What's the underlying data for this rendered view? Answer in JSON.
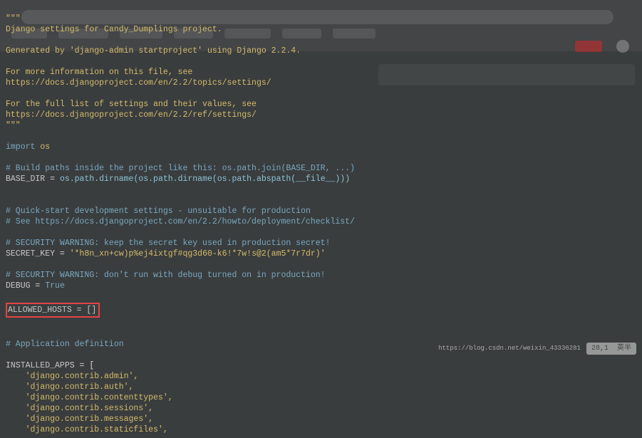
{
  "code": {
    "docstring_open": "\"\"\"",
    "l1": "Django settings for Candy_Dumplings project.",
    "l2": "Generated by 'django-admin startproject' using Django 2.2.4.",
    "l3": "For more information on this file, see",
    "l4": "https://docs.djangoproject.com/en/2.2/topics/settings/",
    "l5": "For the full list of settings and their values, see",
    "l6": "https://docs.djangoproject.com/en/2.2/ref/settings/",
    "docstring_close": "\"\"\"",
    "imp_kw": "import",
    "imp_mod": "os",
    "cmt_build": "# Build paths inside the project like this: os.path.join(BASE_DIR, ...)",
    "base_dir_var": "BASE_DIR",
    "base_dir_eq": " = ",
    "base_dir_expr": "os.path.dirname(os.path.dirname(os.path.abspath(__file__)))",
    "cmt_q1": "# Quick-start development settings - unsuitable for production",
    "cmt_q2": "# See https://docs.djangoproject.com/en/2.2/howto/deployment/checklist/",
    "cmt_sec1": "# SECURITY WARNING: keep the secret key used in production secret!",
    "secret_var": "SECRET_KEY",
    "secret_eq": " = ",
    "secret_val": "'*h8n_xn+cw)p%ej4ixtgf#qg3d60-k6!*7w!s@2(am5*7r7dr)'",
    "cmt_sec2": "# SECURITY WARNING: don't run with debug turned on in production!",
    "debug_var": "DEBUG",
    "debug_eq": " = ",
    "debug_val": "True",
    "allowed": "ALLOWED_HOSTS = []",
    "cmt_app": "# Application definition",
    "inst_var": "INSTALLED_APPS",
    "inst_eq": " = [",
    "app1": "    'django.contrib.admin',",
    "app2": "    'django.contrib.auth',",
    "app3": "    'django.contrib.contenttypes',",
    "app4": "    'django.contrib.sessions',",
    "app5": "    'django.contrib.messages',",
    "app6": "    'django.contrib.staticfiles',"
  },
  "status": {
    "watermark": "https://blog.csdn.net/weixin_43336281",
    "cursor": "28,1",
    "lang": "英半"
  }
}
